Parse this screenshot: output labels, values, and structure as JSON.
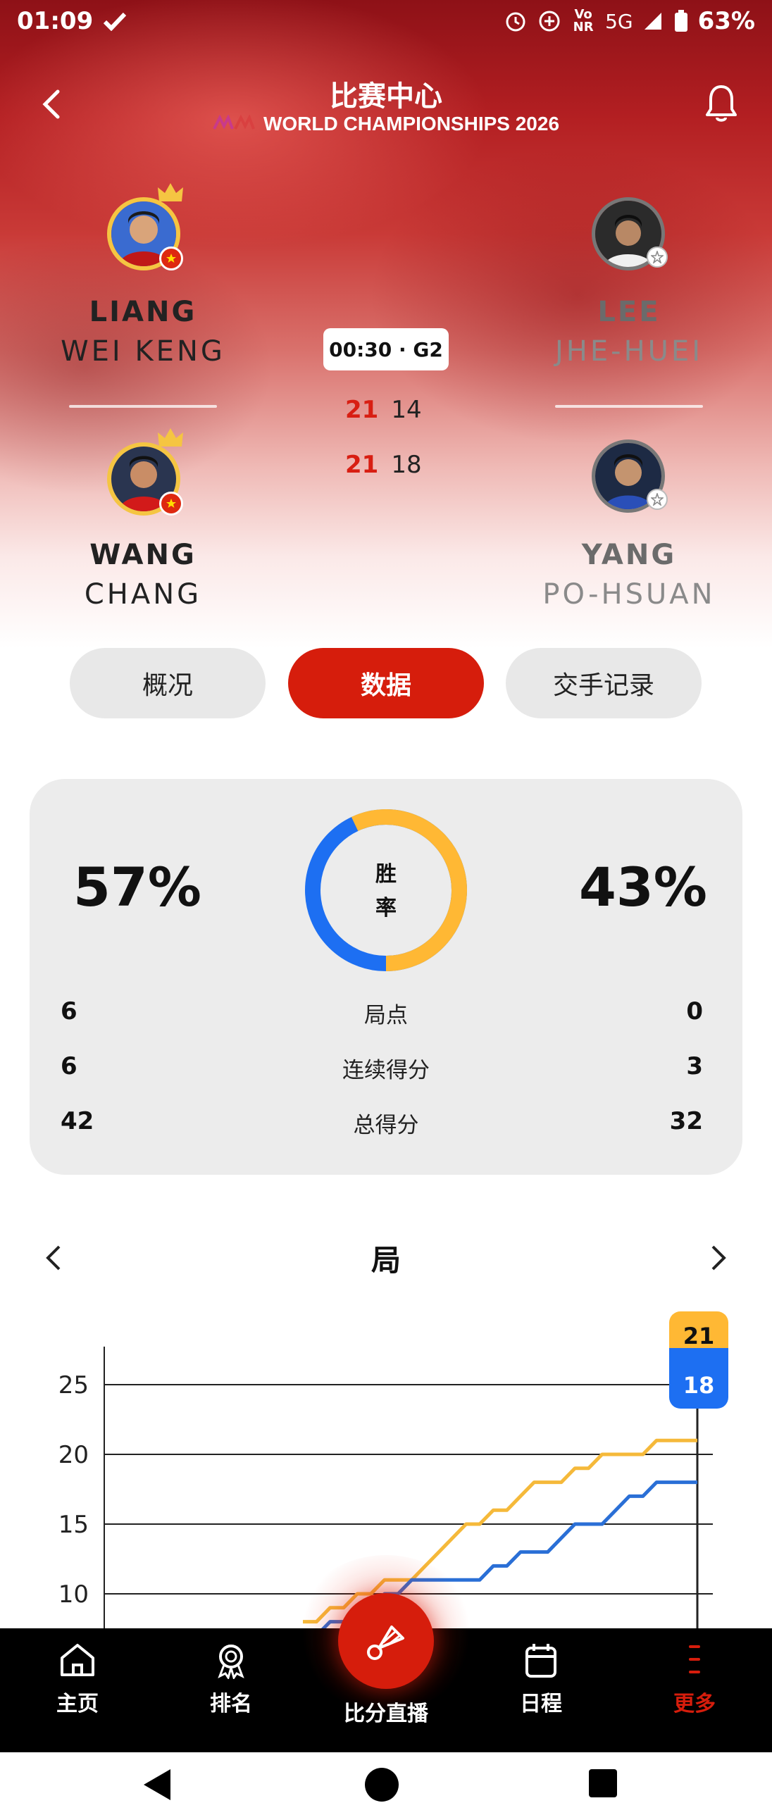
{
  "status_bar": {
    "time": "01:09",
    "network": "5G",
    "volte": "Vo NR",
    "battery": "63%"
  },
  "header": {
    "title": "比赛中心",
    "subtitle": "WORLD CHAMPIONSHIPS 2026"
  },
  "match": {
    "team_left": {
      "player1_first": "LIANG",
      "player1_last": "WEI KENG",
      "player2_first": "WANG",
      "player2_last": "CHANG"
    },
    "team_right": {
      "player1_first": "LEE",
      "player1_last": "JHE-HUEI",
      "player2_first": "YANG",
      "player2_last": "PO-HSUAN"
    },
    "time_game": "00:30 · G2",
    "games": [
      {
        "left": "21",
        "right": "14"
      },
      {
        "left": "21",
        "right": "18"
      }
    ]
  },
  "tabs": [
    "概况",
    "数据",
    "交手记录"
  ],
  "active_tab": 1,
  "stats": {
    "win_left": "57%",
    "win_right": "43%",
    "win_left_fraction": 0.57,
    "donut_label_top": "胜",
    "donut_label_bottom": "率",
    "colors": {
      "left": "#ffb834",
      "right": "#1d6ff2"
    },
    "rows": [
      {
        "name": "局点",
        "left": "6",
        "right": "0"
      },
      {
        "name": "连续得分",
        "left": "6",
        "right": "3"
      },
      {
        "name": "总得分",
        "left": "42",
        "right": "32"
      }
    ]
  },
  "game_chart": {
    "title": "局",
    "badge_left": "21",
    "badge_right": "18"
  },
  "chart_data": {
    "type": "line",
    "title": "局",
    "xlabel": "",
    "ylabel": "",
    "ylim": [
      8,
      27
    ],
    "yticks": [
      "25",
      "20",
      "15",
      "10"
    ],
    "grid": true,
    "x": [
      10,
      11,
      12,
      13,
      14,
      15,
      16,
      17,
      18,
      19,
      20,
      21,
      22,
      23,
      24,
      25,
      26,
      27,
      28,
      29,
      30,
      31,
      32,
      33,
      34,
      35,
      36,
      37,
      38,
      39
    ],
    "series": [
      {
        "color": "#f5b93a",
        "values": [
          8,
          8,
          9,
          9,
          10,
          10,
          11,
          11,
          11,
          12,
          13,
          14,
          15,
          15,
          16,
          16,
          17,
          18,
          18,
          18,
          19,
          19,
          20,
          20,
          20,
          20,
          21,
          21,
          21,
          21
        ]
      },
      {
        "color": "#2a6fd6",
        "values": [
          7,
          7,
          8,
          8,
          9,
          9,
          10,
          10,
          11,
          11,
          11,
          11,
          11,
          11,
          12,
          12,
          13,
          13,
          13,
          14,
          15,
          15,
          15,
          16,
          17,
          17,
          18,
          18,
          18,
          18
        ]
      }
    ]
  },
  "bottom_nav": [
    {
      "label": "主页",
      "icon": "home-icon"
    },
    {
      "label": "排名",
      "icon": "ranking-icon"
    },
    {
      "label": "比分直播",
      "icon": "shuttlecock-icon"
    },
    {
      "label": "日程",
      "icon": "calendar-icon"
    },
    {
      "label": "更多",
      "icon": "more-icon"
    }
  ]
}
